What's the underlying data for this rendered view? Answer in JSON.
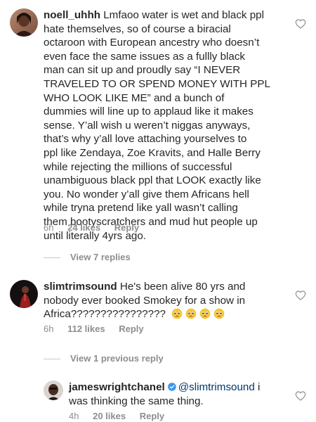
{
  "comments": [
    {
      "username": "noell_uhhh",
      "lines": [
        " Lmfaoo water is wet and black ppl",
        "hate themselves, so of course a biracial",
        "octaroon with European ancestry who doesn’t",
        "even face the same issues as a fullly black",
        "man can sit up and proudly say “I NEVER",
        "TRAVELED TO OR SPEND MONEY WITH PPL",
        "WHO LOOK LIKE ME” and a bunch of",
        "dummies will line up to applaud like it makes",
        "sense. Y’all wish u weren’t niggas anyways,",
        "that’s why y’all love attaching yourselves to",
        "ppl like Zendaya, Zoe Kravits, and Halle Berry",
        "while rejecting the millions of successful",
        "unambiguous black ppl that LOOK exactly like",
        "you. No wonder y’all give them Africans hell",
        "while tryna pretend like yall wasn’t calling",
        "them bootyscratchers and mud hut people up",
        "until literally 4yrs ago."
      ],
      "time": "6h",
      "likes": "24 likes",
      "reply": "Reply",
      "view_replies": "View 7 replies"
    },
    {
      "username": "slimtrimsound",
      "line1": " He's been alive 80 yrs and",
      "line2": "nobody ever booked Smokey for a show in",
      "line3": "Africa????????????????",
      "emoji_name": "pleading-face-emoji",
      "emoji_count": 4,
      "time": "6h",
      "likes": "112 likes",
      "reply": "Reply",
      "view_replies": "View 1 previous reply"
    },
    {
      "username": "jameswrightchanel",
      "mention": "@slimtrimsound",
      "line1_tail": " i",
      "line2": "was thinking the same thing.",
      "time": "4h",
      "likes": "20 likes",
      "reply": "Reply"
    }
  ],
  "colors": {
    "text": "#262626",
    "meta": "#8e8e8e",
    "mention": "#00376b",
    "verified": "#3897f0",
    "background": "#ffffff"
  },
  "icons": {
    "like": "heart-outline-icon",
    "verified": "verified-badge-icon"
  }
}
